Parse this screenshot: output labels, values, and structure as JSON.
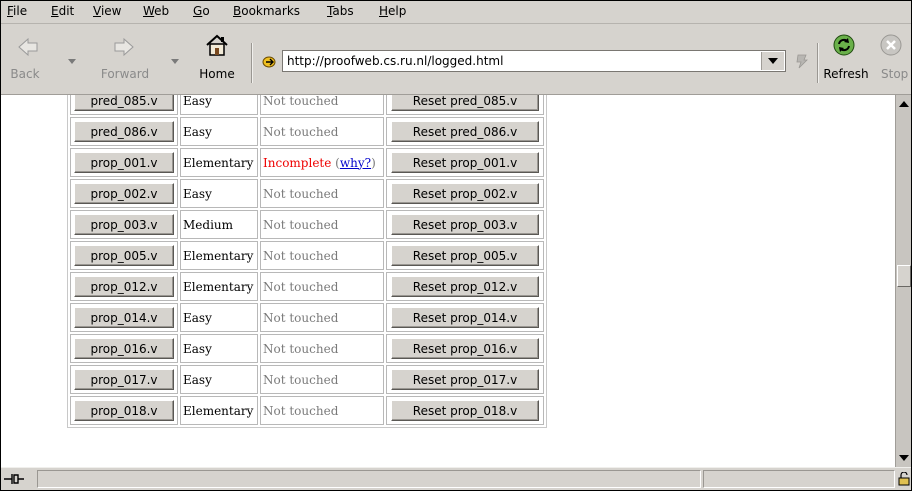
{
  "menubar": {
    "items": [
      {
        "label": "File",
        "u": "F",
        "rest": "ile"
      },
      {
        "label": "Edit",
        "u": "E",
        "rest": "dit"
      },
      {
        "label": "View",
        "u": "V",
        "rest": "iew"
      },
      {
        "label": "Web",
        "u": "W",
        "rest": "eb"
      },
      {
        "label": "Go",
        "u": "G",
        "rest": "o"
      },
      {
        "label": "Bookmarks",
        "u": "B",
        "rest": "ookmarks"
      },
      {
        "label": "Tabs",
        "u": "T",
        "rest": "abs"
      },
      {
        "label": "Help",
        "u": "H",
        "rest": "elp"
      }
    ]
  },
  "toolbar": {
    "back_label": "Back",
    "forward_label": "Forward",
    "home_label": "Home",
    "refresh_label": "Refresh",
    "stop_label": "Stop"
  },
  "address": {
    "url": "http://proofweb.cs.ru.nl/logged.html"
  },
  "table": {
    "rows": [
      {
        "file": "pred_085.v",
        "difficulty": "Easy",
        "status": "Not touched",
        "reset": "Reset pred_085.v"
      },
      {
        "file": "pred_086.v",
        "difficulty": "Easy",
        "status": "Not touched",
        "reset": "Reset pred_086.v"
      },
      {
        "file": "prop_001.v",
        "difficulty": "Elementary",
        "status": "Incomplete",
        "why": "why?",
        "reset": "Reset prop_001.v"
      },
      {
        "file": "prop_002.v",
        "difficulty": "Easy",
        "status": "Not touched",
        "reset": "Reset prop_002.v"
      },
      {
        "file": "prop_003.v",
        "difficulty": "Medium",
        "status": "Not touched",
        "reset": "Reset prop_003.v"
      },
      {
        "file": "prop_005.v",
        "difficulty": "Elementary",
        "status": "Not touched",
        "reset": "Reset prop_005.v"
      },
      {
        "file": "prop_012.v",
        "difficulty": "Elementary",
        "status": "Not touched",
        "reset": "Reset prop_012.v"
      },
      {
        "file": "prop_014.v",
        "difficulty": "Easy",
        "status": "Not touched",
        "reset": "Reset prop_014.v"
      },
      {
        "file": "prop_016.v",
        "difficulty": "Easy",
        "status": "Not touched",
        "reset": "Reset prop_016.v"
      },
      {
        "file": "prop_017.v",
        "difficulty": "Easy",
        "status": "Not touched",
        "reset": "Reset prop_017.v"
      },
      {
        "file": "prop_018.v",
        "difficulty": "Elementary",
        "status": "Not touched",
        "reset": "Reset prop_018.v"
      }
    ]
  },
  "colors": {
    "chrome": "#d6d3ce",
    "incomplete": "#ee0000",
    "link": "#0000cc",
    "muted": "#7a7a7a"
  }
}
